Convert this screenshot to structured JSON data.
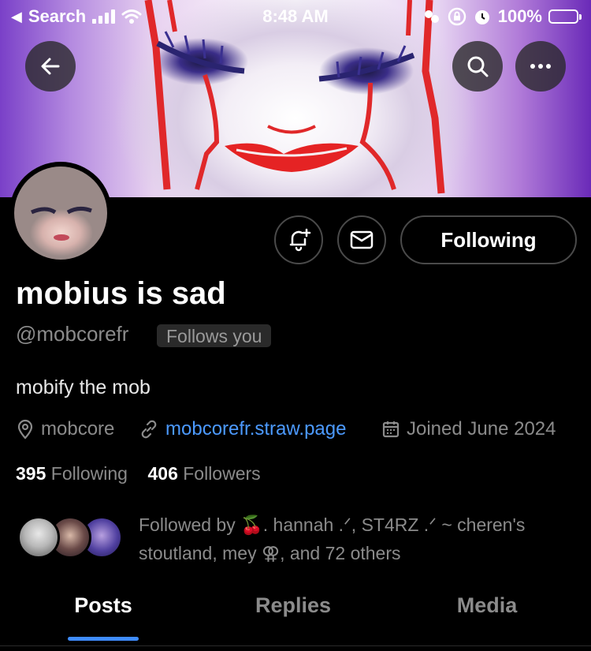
{
  "status_bar": {
    "back_app": "Search",
    "time": "8:48 AM",
    "battery": "100%"
  },
  "nav": {
    "back_icon": "arrow-left-icon",
    "search_icon": "search-icon",
    "more_icon": "ellipsis-icon"
  },
  "profile": {
    "display_name": "mobius is sad",
    "handle": "@mobcorefr",
    "follows_you": "Follows you",
    "bio": "mobify the mob",
    "location": "mobcore",
    "website": "mobcorefr.straw.page",
    "joined": "Joined June 2024"
  },
  "actions": {
    "notify_icon": "bell-plus-icon",
    "message_icon": "envelope-icon",
    "follow_state": "Following"
  },
  "counts": {
    "following_count": "395",
    "following_label": "Following",
    "followers_count": "406",
    "followers_label": "Followers"
  },
  "followed_by": {
    "text": "Followed by 🍒. hannah .ᐟ, ST4RZ .ᐟ ~ cheren's stoutland, mey ⚢, and 72 others"
  },
  "tabs": [
    "Posts",
    "Replies",
    "Media"
  ],
  "colors": {
    "background": "#000000",
    "link": "#4c9aff",
    "tab_indicator": "#3f8cff",
    "muted_text": "#8b8b8b"
  }
}
